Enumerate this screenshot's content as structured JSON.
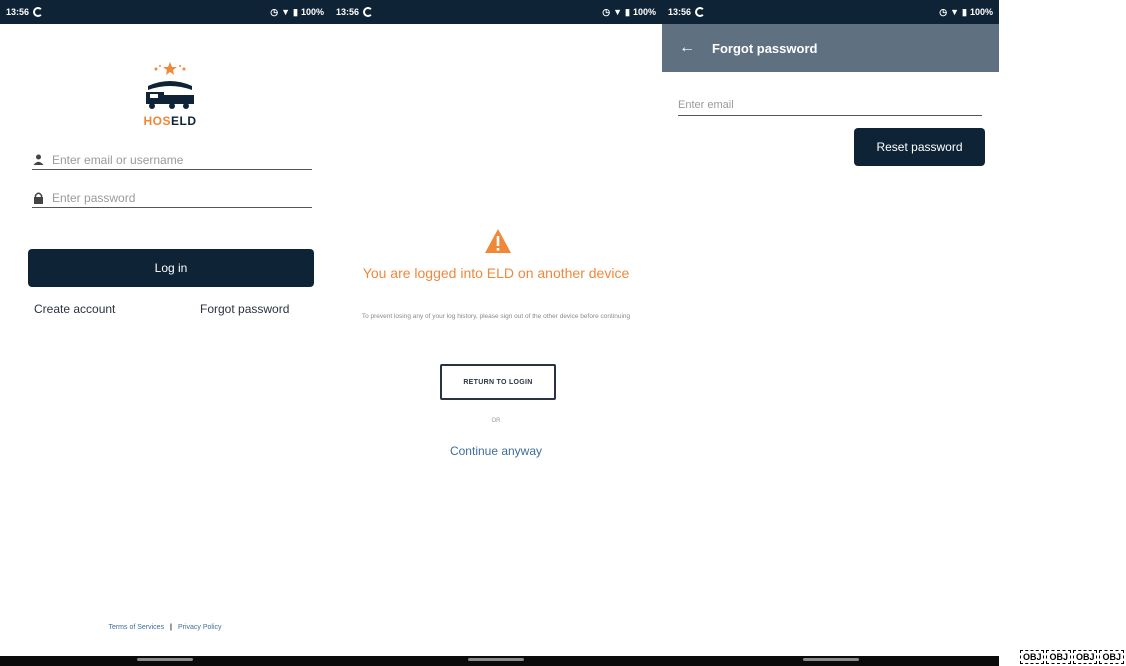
{
  "status_bar": {
    "time": "13:56",
    "battery": "100%"
  },
  "login": {
    "logo_hos": "HOS",
    "logo_eld": "ELD",
    "email_placeholder": "Enter email or username",
    "password_placeholder": "Enter password",
    "login_button": "Log in",
    "create_account": "Create account",
    "forgot_password": "Forgot password",
    "terms": "Terms of Services",
    "separator": "|",
    "privacy": "Privacy Policy"
  },
  "conflict": {
    "title": "You are logged into ELD on another device",
    "subtitle": "To prevent losing any of your log history, please sign out of the other device before continuing",
    "return_button": "RETURN TO LOGIN",
    "or": "OR",
    "continue": "Continue anyway"
  },
  "forgot": {
    "title": "Forgot password",
    "email_placeholder": "Enter email",
    "reset_button": "Reset password"
  },
  "markers": [
    "OBJ",
    "OBJ",
    "OBJ",
    "OBJ"
  ],
  "colors": {
    "navy": "#0f2336",
    "orange": "#f0883a",
    "appbar": "#5f7180",
    "link": "#3e6e99"
  }
}
